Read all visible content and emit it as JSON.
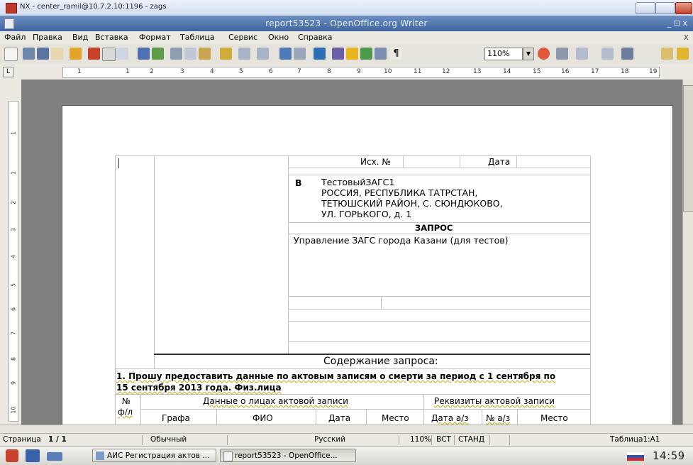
{
  "vnc": {
    "title": "NX - center_ramil@10.7.2.10:1196 - zags"
  },
  "window": {
    "title": "report53523 - OpenOffice.org Writer",
    "controls": "_ ⊡ x"
  },
  "menu": {
    "items": [
      "Файл",
      "Правка",
      "Вид",
      "Вставка",
      "Формат",
      "Таблица",
      "Сервис",
      "Окно",
      "Справка"
    ],
    "close": "x"
  },
  "toolbar": {
    "zoom": "110%"
  },
  "ruler": {
    "corner": "L",
    "marks": [
      "1",
      "1",
      "2",
      "3",
      "4",
      "5",
      "6",
      "7",
      "8",
      "9",
      "10",
      "11",
      "12",
      "13",
      "14",
      "15",
      "16",
      "17",
      "18",
      "19"
    ],
    "vmarks": [
      "1",
      "1",
      "2",
      "3",
      "4",
      "5",
      "6",
      "7",
      "8",
      "9",
      "10"
    ]
  },
  "document": {
    "out_no_label": "Исх. №",
    "date_label": "Дата",
    "to_prefix": "В",
    "recipient_lines": [
      "ТестовыйЗАГС1",
      "РОССИЯ, РЕСПУБЛИКА ТАТРСТАН,",
      "ТЕТЮШСКИЙ РАЙОН, С. СЮНДЮКОВО,",
      "УЛ. ГОРЬКОГО, д. 1"
    ],
    "heading": "ЗАПРОС",
    "sender": "Управление ЗАГС города Казани (для тестов)",
    "content_heading": "Содержание запроса:",
    "request_line1": "1. Прошу предоставить данные по актовым записям о смерти за период с 1 сентября по",
    "request_line2": "15 сентября 2013 года. Физ.лица",
    "table": {
      "num_col": "№",
      "num_col2": "ф/л",
      "group1": "Данные о лицах актовой записи",
      "group2": "Реквизиты актовой записи",
      "headers": [
        "Графа",
        "ФИО",
        "Дата",
        "Место",
        "Дата а/з",
        "№ а/з",
        "Место"
      ]
    }
  },
  "status": {
    "page_label": "Страница",
    "page": "1 / 1",
    "style": "Обычный",
    "language": "Русский",
    "zoom": "110%",
    "insert_mode": "ВСТ",
    "selection_mode": "СТАНД",
    "cell": "Таблица1:A1"
  },
  "taskbar": {
    "tasks": [
      {
        "label": "АИС Регистрация актов ..."
      },
      {
        "label": "report53523 - OpenOffice..."
      }
    ],
    "clock": "14:59"
  },
  "colors": {
    "title_bar": "#4f74ad",
    "page": "#ffffff",
    "workspace": "#808080"
  }
}
